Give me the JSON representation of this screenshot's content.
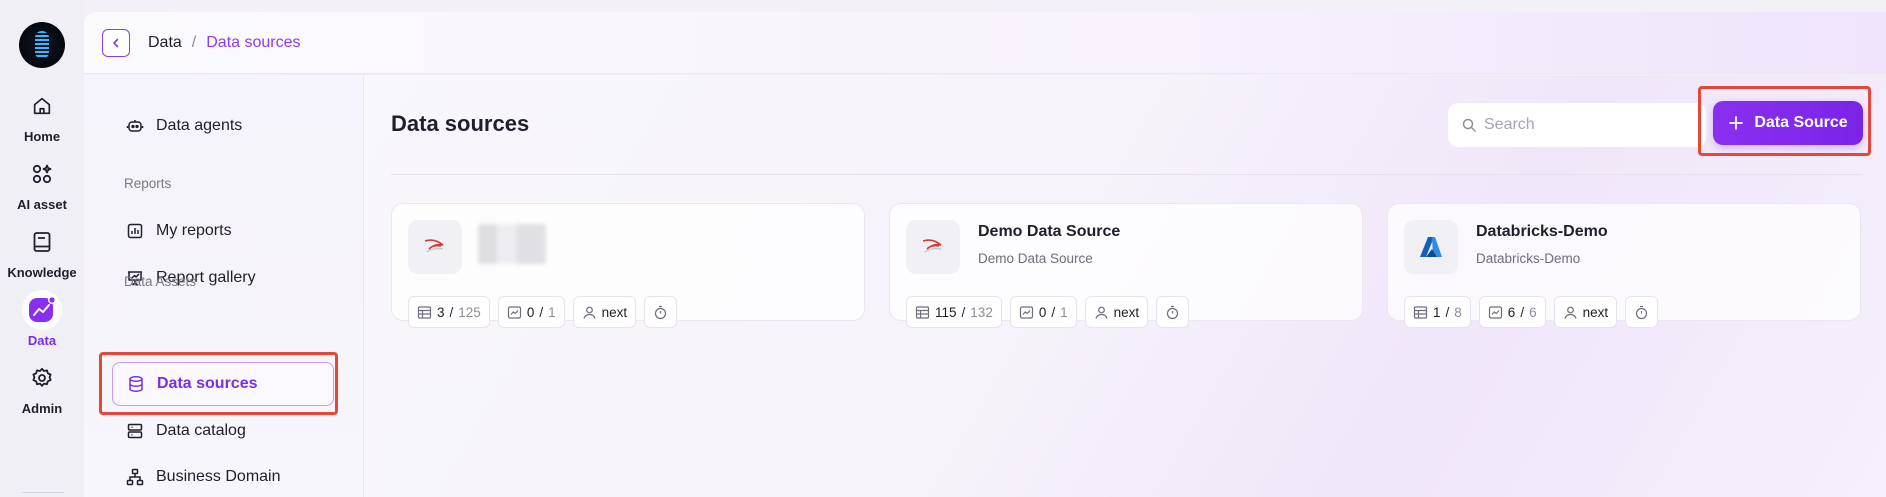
{
  "rail": {
    "items": [
      {
        "label": "Home",
        "icon": "home-icon"
      },
      {
        "label": "AI asset",
        "icon": "ai-asset-icon"
      },
      {
        "label": "Knowledge",
        "icon": "book-icon"
      },
      {
        "label": "Data",
        "icon": "data-chart-icon",
        "active": true
      },
      {
        "label": "Admin",
        "icon": "gear-icon"
      }
    ]
  },
  "breadcrumb": {
    "root": "Data",
    "separator": "/",
    "current": "Data sources"
  },
  "subnav": {
    "data_agents": "Data agents",
    "reports_section": "Reports",
    "my_reports": "My reports",
    "report_gallery": "Report gallery",
    "data_assets_section": "Data Assets",
    "data_sources": "Data sources",
    "data_catalog": "Data catalog",
    "business_domain": "Business Domain"
  },
  "main": {
    "title": "Data sources",
    "search_placeholder": "Search",
    "add_button_label": "Data Source",
    "cards": [
      {
        "title": "",
        "subtitle": "",
        "tables": {
          "num": "3",
          "den": "125"
        },
        "metrics": {
          "num": "0",
          "den": "1"
        },
        "owner": "next"
      },
      {
        "title": "Demo Data Source",
        "subtitle": "Demo Data Source",
        "tables": {
          "num": "115",
          "den": "132"
        },
        "metrics": {
          "num": "0",
          "den": "1"
        },
        "owner": "next"
      },
      {
        "title": "Databricks-Demo",
        "subtitle": "Databricks-Demo",
        "tables": {
          "num": "1",
          "den": "8"
        },
        "metrics": {
          "num": "6",
          "den": "6"
        },
        "owner": "next"
      }
    ]
  },
  "colors": {
    "accent": "#7a2fe0",
    "highlight_box": "#e5483b"
  }
}
